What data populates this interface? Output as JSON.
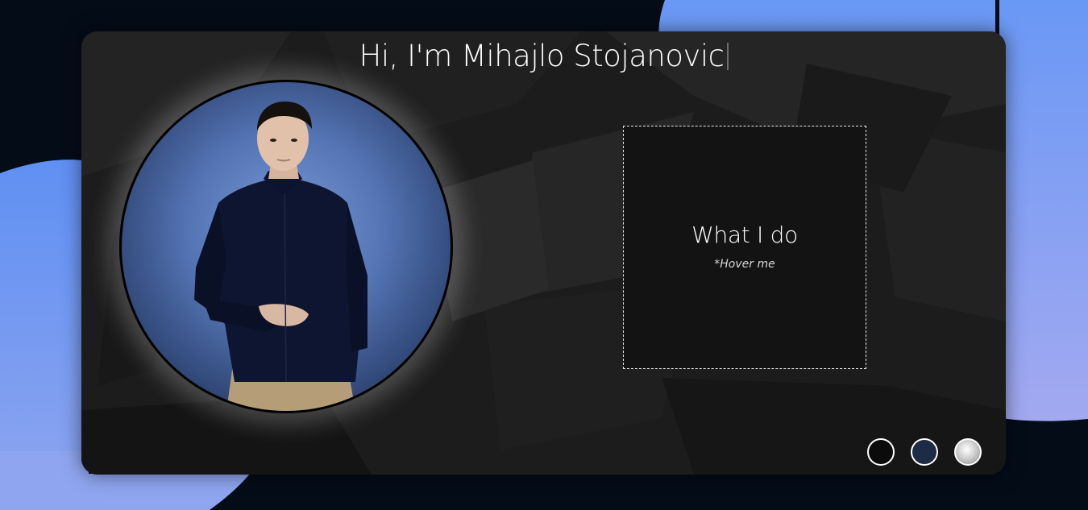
{
  "page": {
    "colors": {
      "background_dark": "#040c18",
      "blob_top_right": "#6a98f5",
      "blob_left": "#6e9cf5",
      "card_bg": "#1b1b1b",
      "text": "#ffffff"
    }
  },
  "hero": {
    "headline": "Hi, I'm Mihajlo Stojanovic",
    "portrait_alt": "Portrait of Mihajlo Stojanovic"
  },
  "what_i_do": {
    "title": "What I do",
    "hint": "*Hover me"
  },
  "theme_switcher": {
    "options": [
      {
        "name": "dark",
        "color": "#0b0b0b"
      },
      {
        "name": "navy",
        "color": "#1e2b44"
      },
      {
        "name": "light",
        "color": "#cfcfcf"
      }
    ]
  }
}
